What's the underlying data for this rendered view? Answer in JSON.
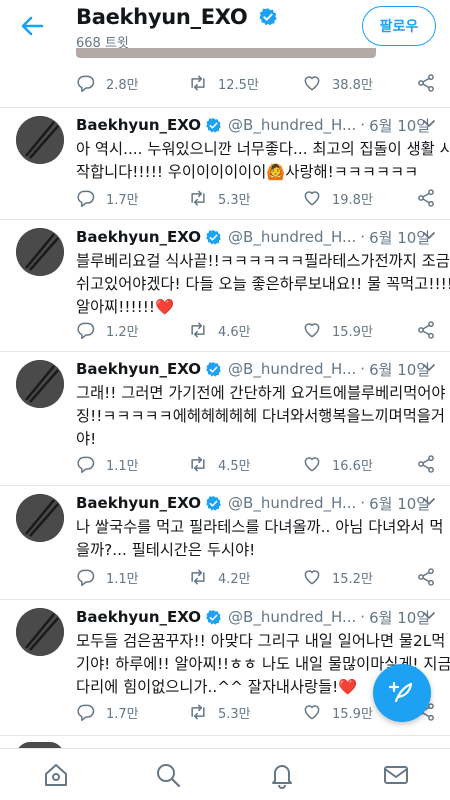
{
  "header": {
    "title": "Baekhyun_EXO",
    "subtitle": "668 트윗",
    "follow_label": "팔로우"
  },
  "top_actions": {
    "replies": "2.8만",
    "retweets": "12.5만",
    "likes": "38.8만"
  },
  "tweets": [
    {
      "name": "Baekhyun_EXO",
      "handle": "@B_hundred_H...",
      "dot": "·",
      "date": "6월 10일",
      "lines": [
        "아 역시.... 누워있으니깐 너무좋다... 최고의 집돌이 생활 시",
        "작합니다!!!!! 우이이이이이이🙆사랑해!ㅋㅋㅋㅋㅋㅋ"
      ],
      "replies": "1.7만",
      "retweets": "5.3만",
      "likes": "19.8만"
    },
    {
      "name": "Baekhyun_EXO",
      "handle": "@B_hundred_H...",
      "dot": "·",
      "date": "6월 10일",
      "lines": [
        "블루베리요걸 식사끝!!ㅋㅋㅋㅋㅋㅋ필라테스가전까지 조금",
        "쉬고있어야겠다! 다들 오늘 좋은하루보내요!! 물 꼭먹고!!!!",
        "알아찌!!!!!!❤️"
      ],
      "replies": "1.2만",
      "retweets": "4.6만",
      "likes": "15.9만"
    },
    {
      "name": "Baekhyun_EXO",
      "handle": "@B_hundred_H...",
      "dot": "·",
      "date": "6월 10일",
      "lines": [
        "그래!! 그러면 가기전에 간단하게 요거트에블루베리먹어야",
        "징!!ㅋㅋㅋㅋㅋ에헤헤헤헤헤 다녀와서행복을느끼며먹을거",
        "야!"
      ],
      "replies": "1.1만",
      "retweets": "4.5만",
      "likes": "16.6만"
    },
    {
      "name": "Baekhyun_EXO",
      "handle": "@B_hundred_H...",
      "dot": "·",
      "date": "6월 10일",
      "lines": [
        "나 쌀국수를 먹고 필라테스를 다녀올까.. 아님 다녀와서 먹",
        "을까?... 필테시간은 두시야!"
      ],
      "replies": "1.1만",
      "retweets": "4.2만",
      "likes": "15.2만"
    },
    {
      "name": "Baekhyun_EXO",
      "handle": "@B_hundred_H...",
      "dot": "·",
      "date": "6월 10일",
      "lines": [
        "모두들 검은꿈꾸자!! 아맞다 그리구 내일 일어나면 물2L먹",
        "기야! 하루에!! 알아찌!!ㅎㅎ 나도 내일 물많이마실게! 지금",
        "다리에 힘이없으니가..^^ 잘자내사랑들!❤️"
      ],
      "replies": "1.7만",
      "retweets": "5.3만",
      "likes": "15.9만"
    }
  ],
  "colors": {
    "accent": "#1da1f2",
    "muted": "#657786",
    "divider": "#e1e8ed"
  },
  "icons": [
    "back-arrow-icon",
    "verified-badge-icon",
    "reply-icon",
    "retweet-icon",
    "like-icon",
    "share-icon",
    "caret-down-icon",
    "compose-icon",
    "home-icon",
    "search-icon",
    "notifications-icon",
    "messages-icon"
  ]
}
